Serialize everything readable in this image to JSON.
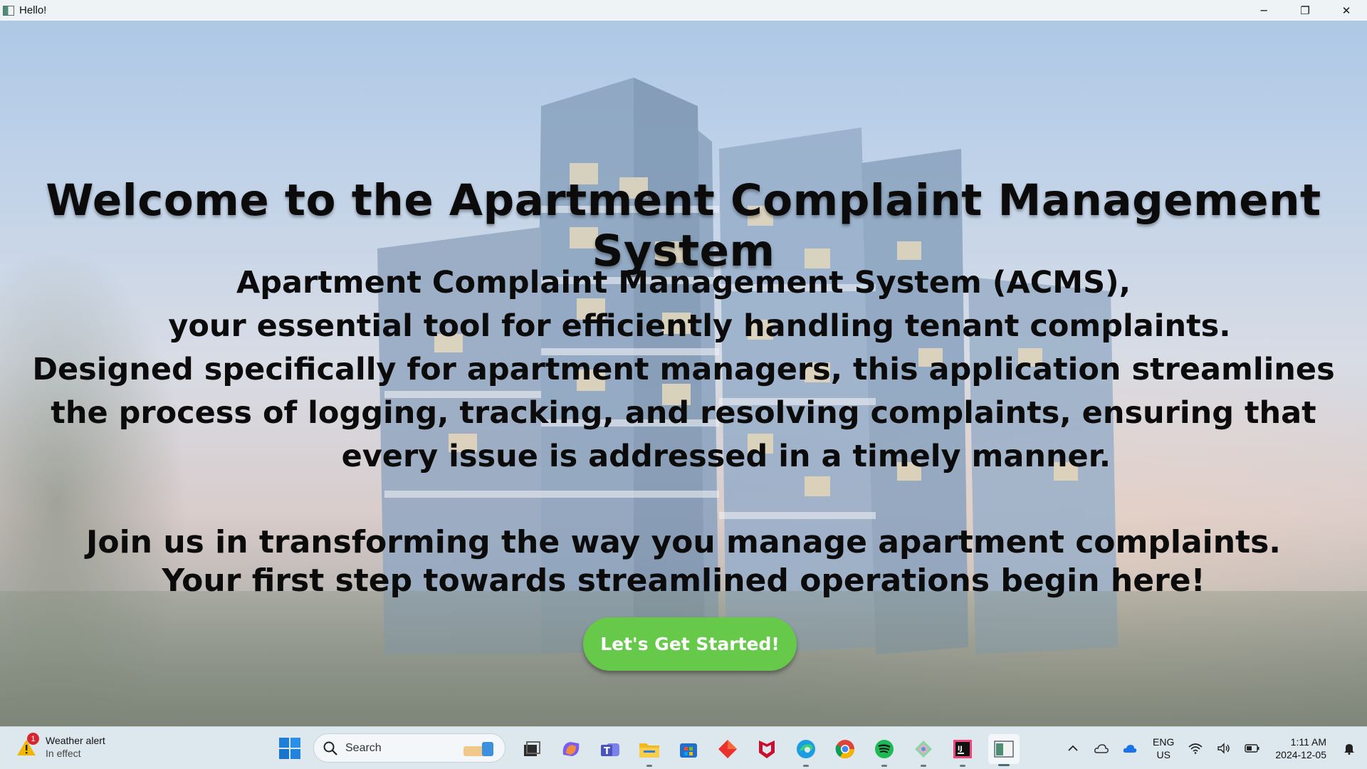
{
  "window": {
    "title": "Hello!",
    "controls": {
      "minimize": "─",
      "restore": "❐",
      "close": "✕"
    }
  },
  "hero": {
    "heading": "Welcome to the Apartment Complaint Management System",
    "description_lines": [
      "Apartment Complaint Management System (ACMS),",
      "   your essential tool for efficiently handling tenant complaints.",
      "Designed specifically for apartment managers, this application streamlines",
      "the process of logging, tracking, and resolving complaints, ensuring that",
      "        every issue is addressed in a timely manner."
    ],
    "call_lines": [
      "Join us in transforming the way you manage apartment complaints.",
      "Your first step towards streamlined operations begin here!"
    ],
    "cta_label": "Let's Get Started!"
  },
  "taskbar": {
    "weather": {
      "badge": "1",
      "title": "Weather alert",
      "subtitle": "In effect"
    },
    "search": {
      "label": "Search"
    },
    "pinned_icons": [
      "task-view-icon",
      "copilot-icon",
      "teams-icon",
      "file-explorer-icon",
      "microsoft-store-icon",
      "red-diamond-app-icon",
      "mcafee-icon",
      "edge-icon",
      "chrome-icon",
      "spotify-icon",
      "tool-app-icon",
      "intellij-icon",
      "java-app-icon"
    ],
    "tray": {
      "chevron": "^",
      "language": "ENG",
      "region": "US",
      "time": "1:11 AM",
      "date": "2024-12-05"
    }
  },
  "colors": {
    "cta_green": "#66c94a",
    "title_bar": "#eef3f6",
    "taskbar": "#dde8ee"
  }
}
